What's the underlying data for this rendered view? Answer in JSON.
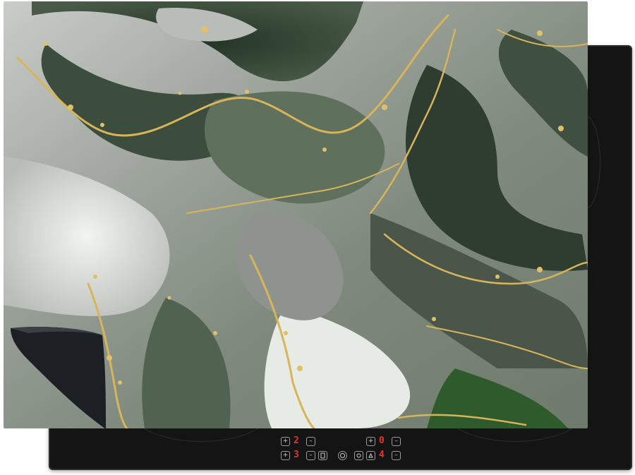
{
  "scene": {
    "subject": "marble-pattern induction hob cover mat",
    "colors": {
      "hob": "#141414",
      "mat_dark_green": "#2f3f31",
      "mat_mid_green": "#5b6b58",
      "mat_grey": "#a8aca8",
      "mat_light": "#e3e6e2",
      "gold_veins": "#d8b45a",
      "display_red": "#e5342b"
    }
  },
  "control_panel": {
    "row1": {
      "left_minus": "–",
      "left_plus": "+",
      "left_digit": "2",
      "right_minus": "–",
      "right_plus": "+",
      "right_digit": "0"
    },
    "row2": {
      "left_plus": "+",
      "left_digit": "3",
      "left_minus": "–",
      "right_digit": "4",
      "right_minus": "–"
    },
    "icons": [
      "power-icon",
      "lock-icon",
      "timer-icon",
      "boost-icon"
    ]
  }
}
